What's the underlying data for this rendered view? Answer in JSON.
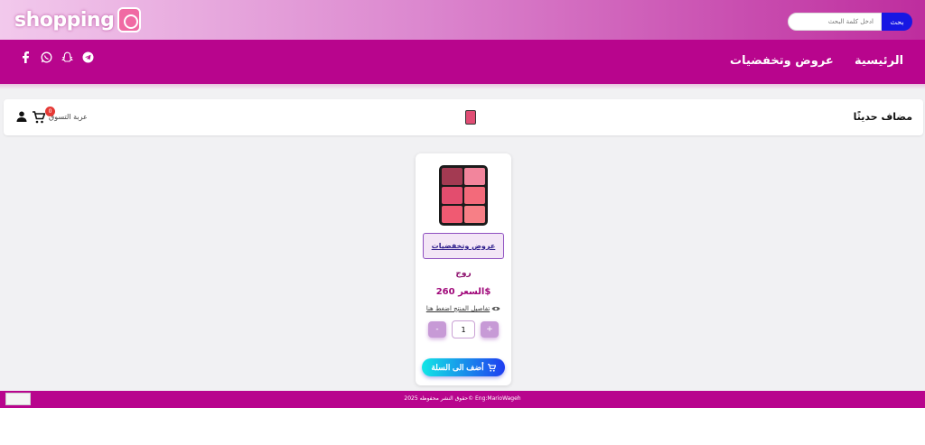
{
  "header": {
    "brand": "shopping",
    "search_placeholder": "ادخل كلمة البحث",
    "search_button": "بحث"
  },
  "nav": {
    "home": "الرئيسية",
    "offers": "عروض وتخفضيات",
    "social_icons": [
      "telegram-icon",
      "snapchat-icon",
      "whatsapp-icon",
      "facebook-icon"
    ]
  },
  "section": {
    "title": "مضاف حديثًا",
    "cart_label": "عربة التسوق",
    "cart_count": "0"
  },
  "product": {
    "category": "عروض وتخفضيات",
    "name": "روج",
    "price": "السعر 260$",
    "details": "تفاصيل المنتج اضغط هنا",
    "qty_minus": "-",
    "qty_plus": "+",
    "qty_value": "1",
    "add_to_cart": "أضف الى السلة"
  },
  "footer": {
    "copyright": "حقوق النشر محفوظه 2025© Eng:MarioWageh"
  },
  "colors": {
    "nav_bg": "#b8058d",
    "accent_blue": "#1717e3",
    "price": "#a0087a"
  }
}
